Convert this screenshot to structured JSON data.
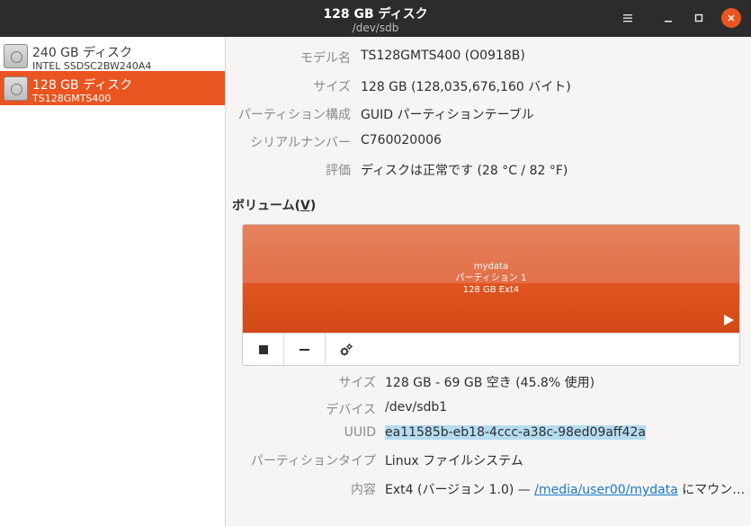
{
  "window": {
    "title": "128 GB ディスク",
    "subtitle": "/dev/sdb"
  },
  "sidebar": {
    "disks": [
      {
        "name": "240 GB ディスク",
        "model": "INTEL SSDSC2BW240A4",
        "selected": false
      },
      {
        "name": "128 GB ディスク",
        "model": "TS128GMTS400",
        "selected": true
      }
    ]
  },
  "disk_info": {
    "model_label": "モデル名",
    "model_value": "TS128GMTS400 (O0918B)",
    "size_label": "サイズ",
    "size_value": "128 GB (128,035,676,160 バイト)",
    "partitioning_label": "パーティション構成",
    "partitioning_value": "GUID パーティションテーブル",
    "serial_label": "シリアルナンバー",
    "serial_value": "C760020006",
    "assessment_label": "評価",
    "assessment_value": "ディスクは正常です (28 °C / 82 °F)"
  },
  "volumes": {
    "title_prefix": "ボリューム(",
    "title_mnemonic": "V",
    "title_suffix": ")",
    "partition": {
      "name": "mydata",
      "number": "パーティション 1",
      "desc": "128 GB Ext4"
    }
  },
  "volume_info": {
    "size_label": "サイズ",
    "size_value": "128 GB - 69 GB 空き (45.8% 使用)",
    "device_label": "デバイス",
    "device_value": "/dev/sdb1",
    "uuid_label": "UUID",
    "uuid_value": "ea11585b-eb18-4ccc-a38c-98ed09aff42a",
    "ptype_label": "パーティションタイプ",
    "ptype_value": "Linux ファイルシステム",
    "contents_label": "内容",
    "contents_prefix": "Ext4 (バージョン 1.0) — ",
    "contents_link": "/media/user00/mydata",
    "contents_suffix": " にマウン…"
  },
  "colors": {
    "accent": "#e95420",
    "titlebar": "#2c2c2c"
  },
  "icons": [
    "hamburger-icon",
    "minimize-icon",
    "maximize-icon",
    "close-icon",
    "disk-icon",
    "play-icon",
    "stop-icon",
    "minus-icon",
    "gears-icon"
  ]
}
